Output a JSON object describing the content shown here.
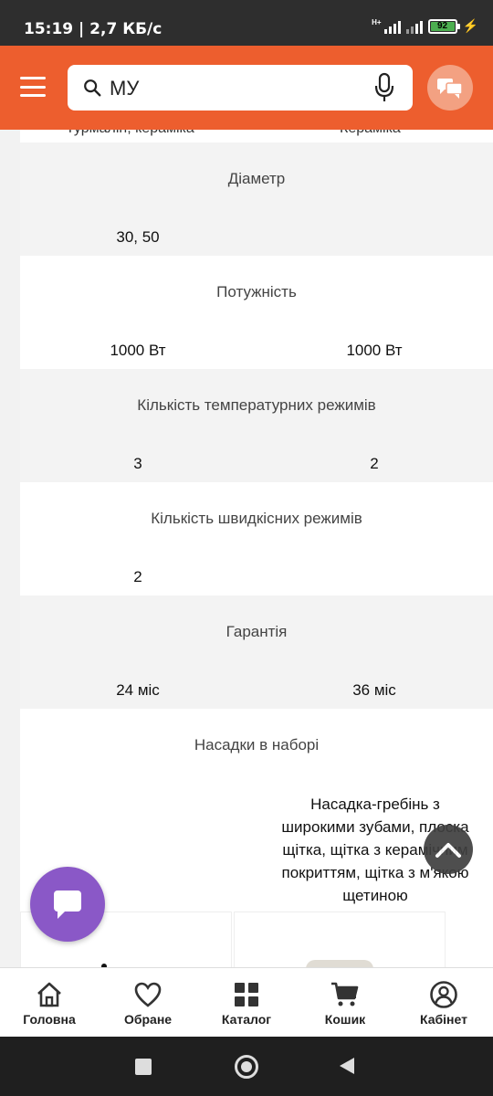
{
  "status": {
    "time": "15:19 | 2,7 КБ/с",
    "battery": "92"
  },
  "search": {
    "value": "МУ"
  },
  "content": {
    "cut_row": {
      "left": "Турмалін, кераміка",
      "right": "Кераміка"
    },
    "specs": [
      {
        "title": "Діаметр",
        "values": [
          "30, 50",
          ""
        ]
      },
      {
        "title": "Потужність",
        "values": [
          "1000 Вт",
          "1000 Вт"
        ]
      },
      {
        "title": "Кількість температурних режимів",
        "values": [
          "3",
          "2"
        ]
      },
      {
        "title": "Кількість швидкісних режимів",
        "values": [
          "2",
          ""
        ]
      },
      {
        "title": "Гарантія",
        "values": [
          "24 міс",
          "36 міс"
        ]
      }
    ],
    "attachments": {
      "title": "Насадки в наборі",
      "right_text": "Насадка-гребінь з широкими зубами, плоска щітка, щітка з керамічним покриттям, щітка з м'якою щетиною"
    }
  },
  "bottom_nav": [
    {
      "label": "Головна",
      "icon": "home-icon"
    },
    {
      "label": "Обране",
      "icon": "heart-icon"
    },
    {
      "label": "Каталог",
      "icon": "grid-icon"
    },
    {
      "label": "Кошик",
      "icon": "cart-icon"
    },
    {
      "label": "Кабінет",
      "icon": "user-icon"
    }
  ],
  "colors": {
    "brand": "#ed5e2e",
    "chat_fab": "#8a58c7"
  }
}
